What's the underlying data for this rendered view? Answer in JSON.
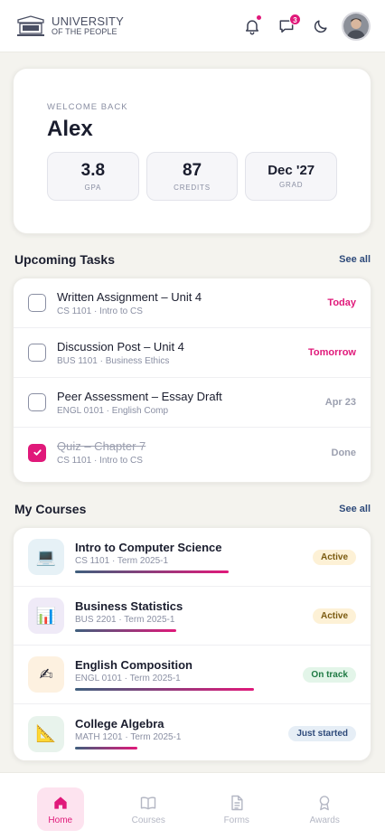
{
  "header": {
    "logo_line1": "UNIVERSITY",
    "logo_line2": "OF THE PEOPLE",
    "message_count": "3",
    "icons": [
      "bell-icon",
      "chat-icon",
      "moon-icon"
    ]
  },
  "welcome": {
    "label": "WELCOME BACK",
    "name": "Alex",
    "stats": [
      {
        "value": "3.8",
        "label": "GPA"
      },
      {
        "value": "87",
        "label": "CREDITS"
      },
      {
        "value": "Dec '27",
        "label": "GRAD"
      }
    ]
  },
  "tasks": {
    "title": "Upcoming Tasks",
    "see_all": "See all",
    "items": [
      {
        "title": "Written Assignment – Unit 4",
        "sub": "CS 1101 · Intro to CS",
        "due": "Today",
        "due_color": "#e0197a",
        "done": false
      },
      {
        "title": "Discussion Post – Unit 4",
        "sub": "BUS 1101 · Business Ethics",
        "due": "Tomorrow",
        "due_color": "#e0197a",
        "done": false
      },
      {
        "title": "Peer Assessment – Essay Draft",
        "sub": "ENGL 0101 · English Comp",
        "due": "Apr 23",
        "due_color": "#9ca0b0",
        "done": false
      },
      {
        "title": "Quiz – Chapter 7",
        "sub": "CS 1101 · Intro to CS",
        "due": "Done",
        "due_color": "#9ca0b0",
        "done": true
      }
    ]
  },
  "courses": {
    "title": "My Courses",
    "see_all": "See all",
    "items": [
      {
        "title": "Intro to Computer Science",
        "sub": "CS 1101 · Term 2025-1",
        "status": "Active",
        "progress": 0.79,
        "icon": "laptop-icon",
        "glyph": "💻",
        "icon_bg": "#e6f1f6",
        "pill_bg": "#fdf1d6",
        "pill_color": "#7a5a10"
      },
      {
        "title": "Business Statistics",
        "sub": "BUS 2201 · Term 2025-1",
        "status": "Active",
        "progress": 0.52,
        "icon": "bar-chart-icon",
        "glyph": "📊",
        "icon_bg": "#efeaf7",
        "pill_bg": "#fdf1d6",
        "pill_color": "#7a5a10"
      },
      {
        "title": "English Composition",
        "sub": "ENGL 0101 · Term 2025-1",
        "status": "On track",
        "progress": 0.92,
        "icon": "writing-hand-icon",
        "glyph": "✍",
        "icon_bg": "#fdf1e0",
        "pill_bg": "#e3f5e9",
        "pill_color": "#1f7a44"
      },
      {
        "title": "College Algebra",
        "sub": "MATH 1201 · Term 2025-1",
        "status": "Just started",
        "progress": 0.32,
        "icon": "triangle-ruler-icon",
        "glyph": "📐",
        "icon_bg": "#e8f3ec",
        "pill_bg": "#e6eef6",
        "pill_color": "#2e4a7a"
      }
    ]
  },
  "nav": {
    "items": [
      {
        "label": "Home",
        "icon": "home-icon",
        "active": true
      },
      {
        "label": "Courses",
        "icon": "book-icon",
        "active": false
      },
      {
        "label": "Forms",
        "icon": "document-icon",
        "active": false
      },
      {
        "label": "Awards",
        "icon": "award-icon",
        "active": false
      }
    ]
  }
}
